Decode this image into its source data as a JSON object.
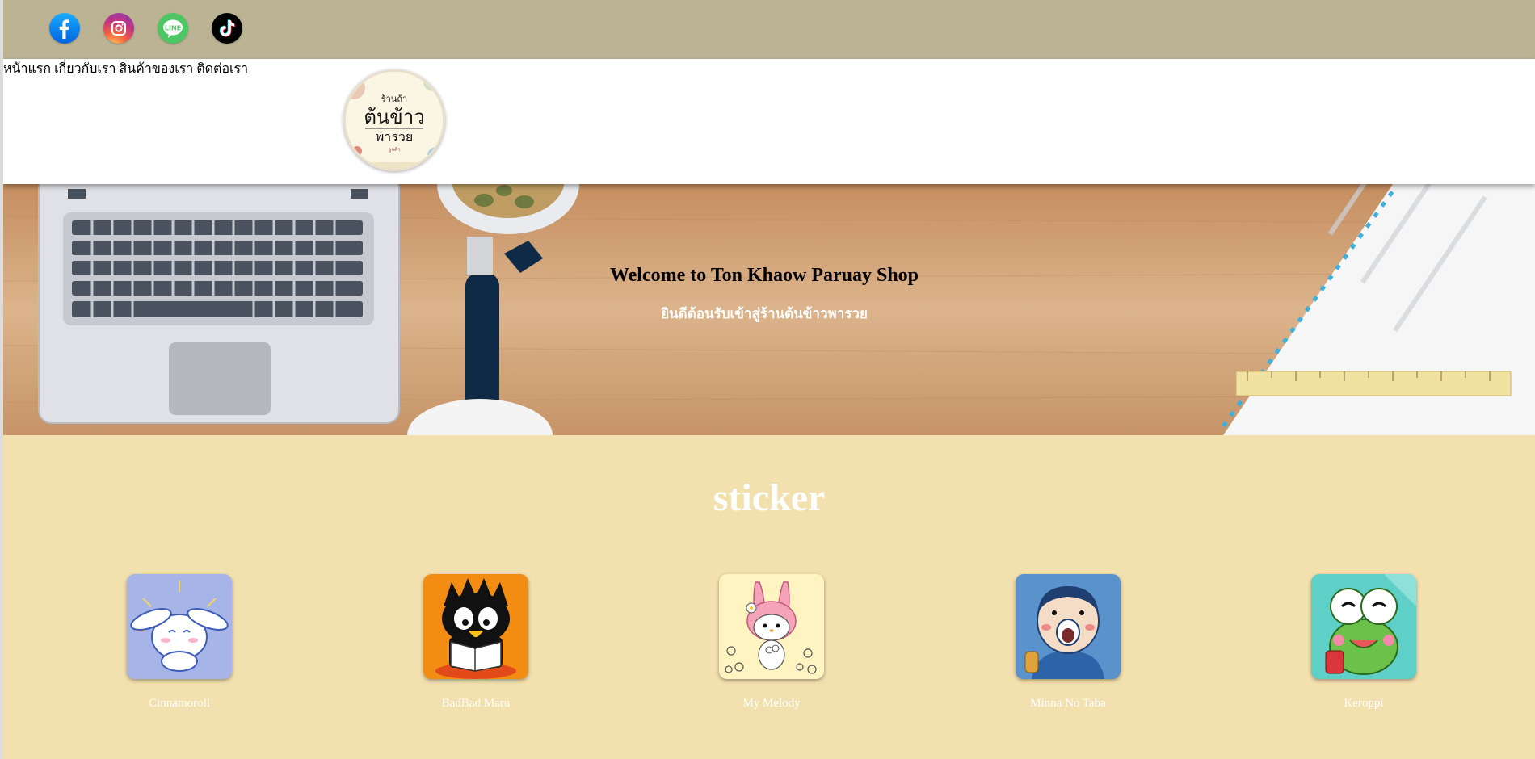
{
  "social": {
    "items": [
      {
        "name": "facebook",
        "icon": "facebook-icon"
      },
      {
        "name": "instagram",
        "icon": "instagram-icon"
      },
      {
        "name": "line",
        "icon": "line-icon",
        "label": "LINE"
      },
      {
        "name": "tiktok",
        "icon": "tiktok-icon"
      }
    ]
  },
  "header": {
    "logo": {
      "line1": "ร้านถ้า",
      "line2": "ต้นข้าว",
      "line3": "พารวย",
      "line4": "ลูกค้า"
    },
    "nav": [
      "หน้าแรก",
      "เกี่ยวกับเรา",
      "สินค้าของเรา",
      "ติดต่อเรา"
    ]
  },
  "hero": {
    "title": "Welcome to Ton Khaow Paruay Shop",
    "subtitle": "ยินดีต้อนรับเข้าสู่ร้านต้นข้าวพารวย"
  },
  "stickers": {
    "title": "sticker",
    "items": [
      {
        "name": "Cinnamoroll",
        "bg": "#a7b4e8"
      },
      {
        "name": "BadBad Maru",
        "bg": "#f28c12"
      },
      {
        "name": "My Melody",
        "bg": "#fdf4c2"
      },
      {
        "name": "Minna No Taba",
        "bg": "#5a92cc"
      },
      {
        "name": "Keroppi",
        "bg": "#5fd0c8"
      }
    ]
  },
  "colors": {
    "social_bar": "#bbb394",
    "section_bg": "#f2e0ae"
  }
}
